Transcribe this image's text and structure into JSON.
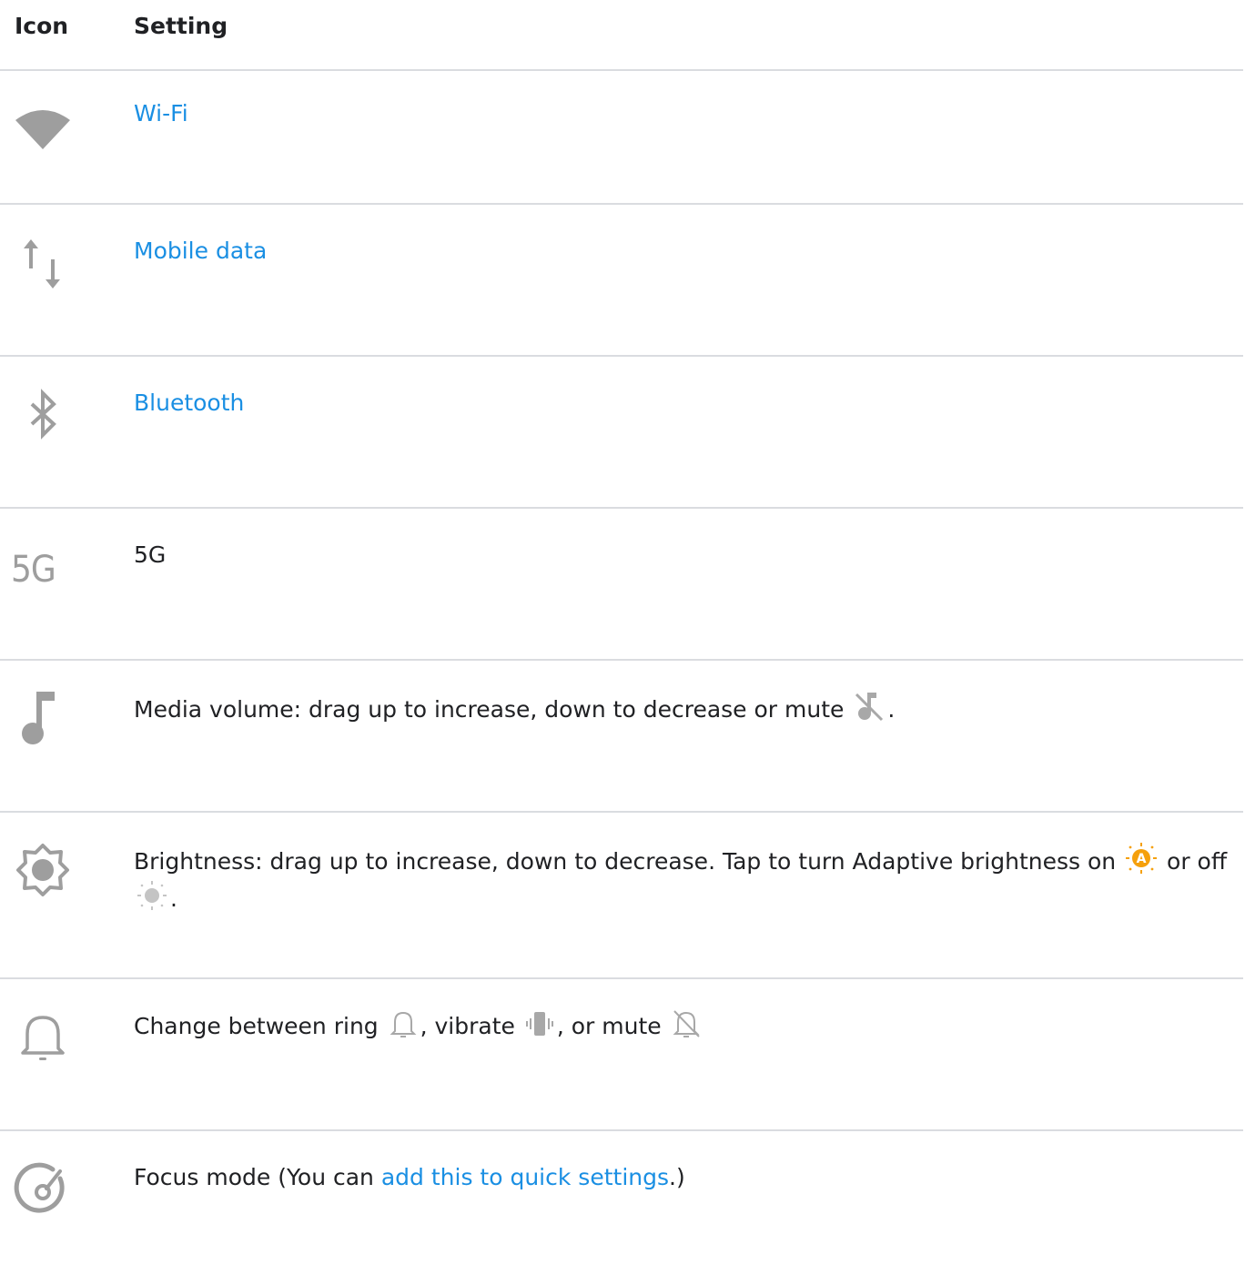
{
  "table": {
    "headers": {
      "icon": "Icon",
      "setting": "Setting"
    },
    "rows": [
      {
        "icon": "wifi-icon",
        "text": "Wi-Fi",
        "is_link": true
      },
      {
        "icon": "mobile-data-icon",
        "text": "Mobile data",
        "is_link": true
      },
      {
        "icon": "bluetooth-icon",
        "text": "Bluetooth",
        "is_link": true
      },
      {
        "icon": "5g-icon",
        "icon_text": "5G",
        "text": "5G",
        "is_link": false
      },
      {
        "icon": "music-note-icon",
        "text_before": "Media volume: drag up to increase, down to decrease or mute",
        "inline_icon": "music-note-off-icon",
        "text_after": "."
      },
      {
        "icon": "brightness-icon",
        "text_before": "Brightness: drag up to increase, down to decrease. Tap to turn Adaptive brightness on",
        "inline_icon_1": "adaptive-brightness-on-icon",
        "text_mid": "or off",
        "inline_icon_2": "adaptive-brightness-off-icon",
        "text_after": "."
      },
      {
        "icon": "bell-icon",
        "text_1": "Change between ring",
        "inline_icon_1": "bell-ring-icon",
        "text_2": ", vibrate",
        "inline_icon_2": "vibrate-icon",
        "text_3": ", or mute",
        "inline_icon_3": "bell-off-icon"
      },
      {
        "icon": "focus-mode-icon",
        "text_before": "Focus mode (You can",
        "link_text": "add this to quick settings",
        "text_after": ".)"
      }
    ]
  },
  "colors": {
    "icon_gray": "#9e9e9e",
    "link": "#1a8fe3",
    "adaptive_orange": "#f5a00c",
    "divider": "#dadce0"
  }
}
